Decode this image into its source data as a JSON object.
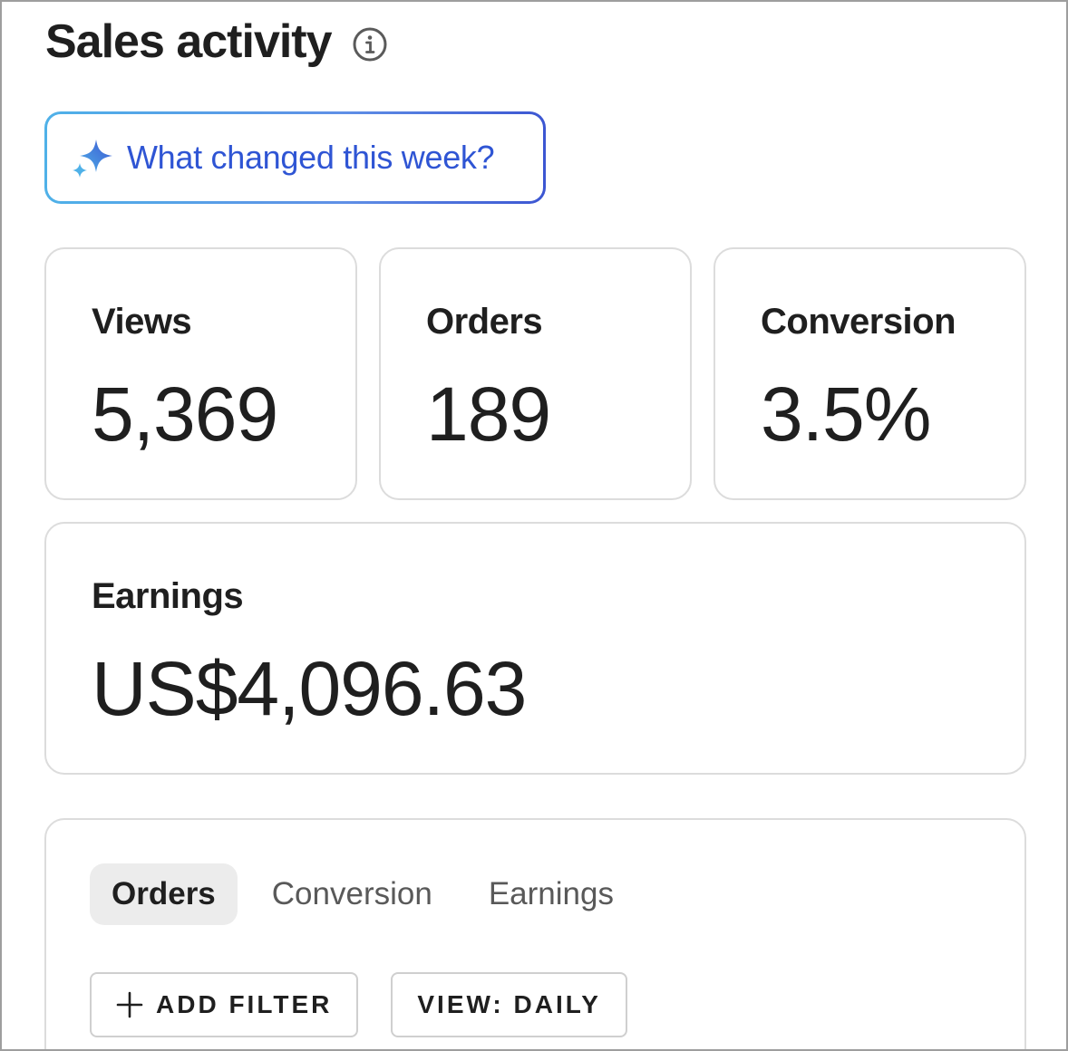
{
  "header": {
    "title": "Sales activity",
    "info_icon": "info-icon"
  },
  "ai_prompt": {
    "label": "What changed this week?",
    "icon": "sparkle-icon",
    "colors": {
      "text": "#2f55d4",
      "border_start": "#4fb1e8",
      "border_end": "#3c56d2"
    }
  },
  "stats": {
    "views": {
      "label": "Views",
      "value": "5,369"
    },
    "orders": {
      "label": "Orders",
      "value": "189"
    },
    "conversion": {
      "label": "Conversion",
      "value": "3.5%"
    }
  },
  "earnings": {
    "label": "Earnings",
    "value": "US$4,096.63"
  },
  "chart_panel": {
    "tabs": [
      {
        "label": "Orders",
        "active": true
      },
      {
        "label": "Conversion",
        "active": false
      },
      {
        "label": "Earnings",
        "active": false
      }
    ],
    "add_filter_label": "ADD FILTER",
    "add_filter_icon": "plus-icon",
    "view_label": "VIEW: DAILY"
  }
}
